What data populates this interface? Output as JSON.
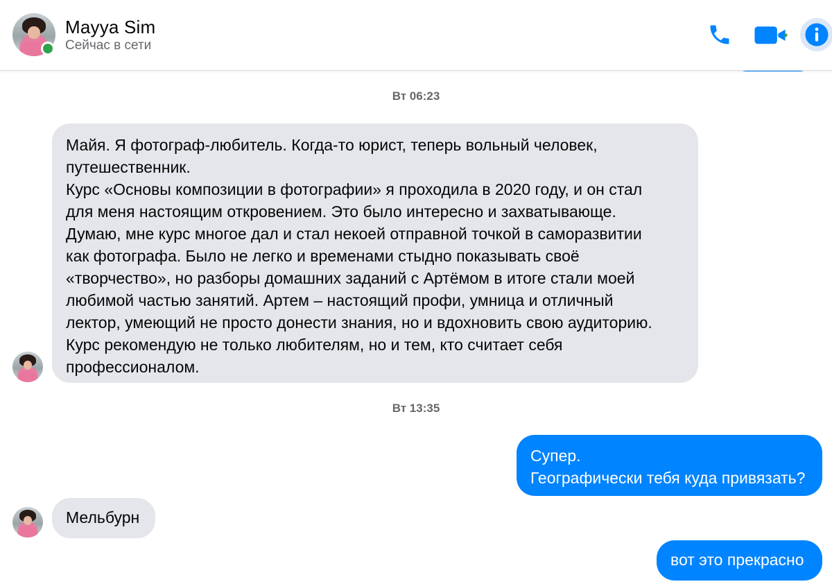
{
  "header": {
    "name": "Mayya Sim",
    "status": "Сейчас в сети",
    "icons": {
      "call": "phone-icon",
      "video": "video-camera-icon",
      "info": "info-icon"
    },
    "accent_color": "#0084ff",
    "online_color": "#31a24c"
  },
  "messages": {
    "timestamp_1": "Вт 06:23",
    "msg_1": "Майя. Я фотограф-любитель. Когда-то юрист, теперь вольный человек, \nпутешественник.\nКурс «Основы композиции в фотографии» я проходила в 2020 году, и он стал \nдля меня настоящим откровением. Это было интересно и захватывающе.\nДумаю, мне курс многое дал и стал некоей отправной точкой в саморазвитии \nкак фотографа. Было не легко и временами стыдно показывать своё \n«творчество», но разборы домашних заданий с Артёмом в итоге стали моей \nлюбимой частью занятий. Артем – настоящий профи, умница и отличный \nлектор, умеющий не просто донести знания, но и вдохновить свою аудиторию.\nКурс рекомендую не только любителям, но и тем, кто считает себя \nпрофессионалом.",
    "timestamp_2": "Вт 13:35",
    "msg_2": "Супер.\nГеографически тебя куда привязать?",
    "msg_3": "Мельбурн",
    "msg_4": "вот это прекрасно"
  },
  "colors": {
    "incoming_bubble": "#e4e6eb",
    "outgoing_bubble": "#0084ff",
    "timestamp_text": "#65676b"
  }
}
